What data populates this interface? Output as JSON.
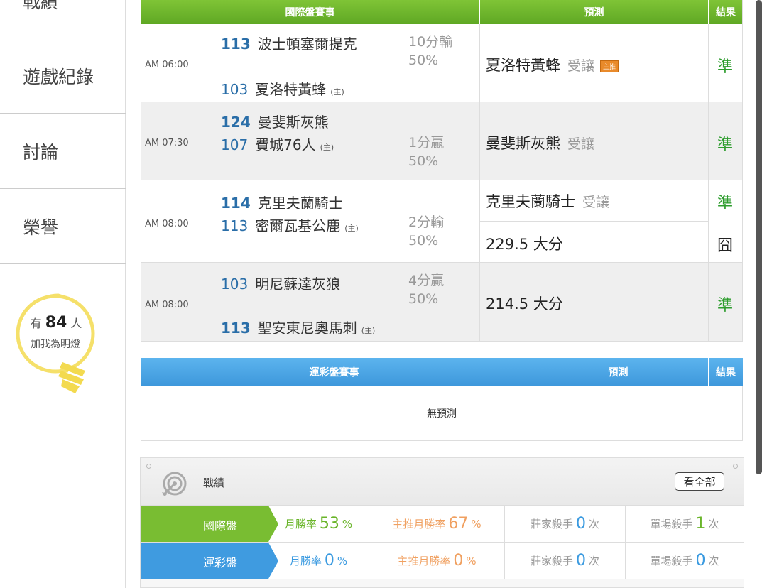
{
  "sidebar": {
    "items": [
      {
        "label": "戰績"
      },
      {
        "label": "遊戲紀錄"
      },
      {
        "label": "討論"
      },
      {
        "label": "榮譽"
      }
    ],
    "bulb": {
      "prefix": "有",
      "count": "84",
      "suffix": "人",
      "line2": "加我為明燈"
    }
  },
  "intl": {
    "headers": {
      "match": "國際盤賽事",
      "prediction": "預測",
      "result": "結果"
    },
    "games": [
      {
        "time": "AM 06:00",
        "teams": [
          {
            "score": "113",
            "name": "波士頓塞爾提克",
            "host": ""
          },
          {
            "score": "103",
            "name": "夏洛特黃蜂",
            "host": "(主)"
          }
        ],
        "odds": [
          "10分輸",
          "50%"
        ],
        "predictions": [
          {
            "main": "夏洛特黃蜂",
            "sub": "受讓",
            "tag": "主推",
            "result": "準"
          }
        ]
      },
      {
        "time": "AM 07:30",
        "teams": [
          {
            "score": "124",
            "name": "曼斐斯灰熊",
            "host": ""
          },
          {
            "score": "107",
            "name": "費城76人",
            "host": "(主)"
          }
        ],
        "odds": [
          "1分贏",
          "50%"
        ],
        "predictions": [
          {
            "main": "曼斐斯灰熊",
            "sub": "受讓",
            "tag": "",
            "result": "準"
          }
        ]
      },
      {
        "time": "AM 08:00",
        "teams": [
          {
            "score": "114",
            "name": "克里夫蘭騎士",
            "host": ""
          },
          {
            "score": "113",
            "name": "密爾瓦基公鹿",
            "host": "(主)"
          }
        ],
        "odds": [
          "2分輸",
          "50%"
        ],
        "predictions": [
          {
            "main": "克里夫蘭騎士",
            "sub": "受讓",
            "tag": "",
            "result": "準"
          },
          {
            "main": "229.5 大分",
            "sub": "",
            "tag": "",
            "result": "囧"
          }
        ]
      },
      {
        "time": "AM 08:00",
        "teams": [
          {
            "score": "103",
            "name": "明尼蘇達灰狼",
            "host": ""
          },
          {
            "score": "113",
            "name": "聖安東尼奧馬刺",
            "host": "(主)"
          }
        ],
        "odds": [
          "4分贏",
          "50%"
        ],
        "predictions": [
          {
            "main": "214.5 大分",
            "sub": "",
            "tag": "",
            "result": "準"
          }
        ]
      }
    ]
  },
  "lottery": {
    "headers": {
      "match": "運彩盤賽事",
      "prediction": "預測",
      "result": "結果"
    },
    "empty": "無預測"
  },
  "stats": {
    "title": "戰績",
    "view_all": "看全部",
    "rows": [
      {
        "label": "國際盤",
        "monthly_label": "月勝率",
        "monthly": "53",
        "main_label": "主推月勝率",
        "main": "67",
        "pct": "%",
        "banker_label": "莊家殺手",
        "banker": "0",
        "single_label": "單場殺手",
        "single": "1",
        "times": "次"
      },
      {
        "label": "運彩盤",
        "monthly_label": "月勝率",
        "monthly": "0",
        "main_label": "主推月勝率",
        "main": "0",
        "pct": "%",
        "banker_label": "莊家殺手",
        "banker": "0",
        "single_label": "單場殺手",
        "single": "0",
        "times": "次"
      }
    ]
  },
  "colors": {
    "green": "#79bd32",
    "blue": "#3f9be0",
    "result_green": "#2e9d2e",
    "orange_tag": "#e98a2a"
  },
  "icons": {
    "bulb": "lightbulb-icon",
    "target": "target-icon"
  }
}
